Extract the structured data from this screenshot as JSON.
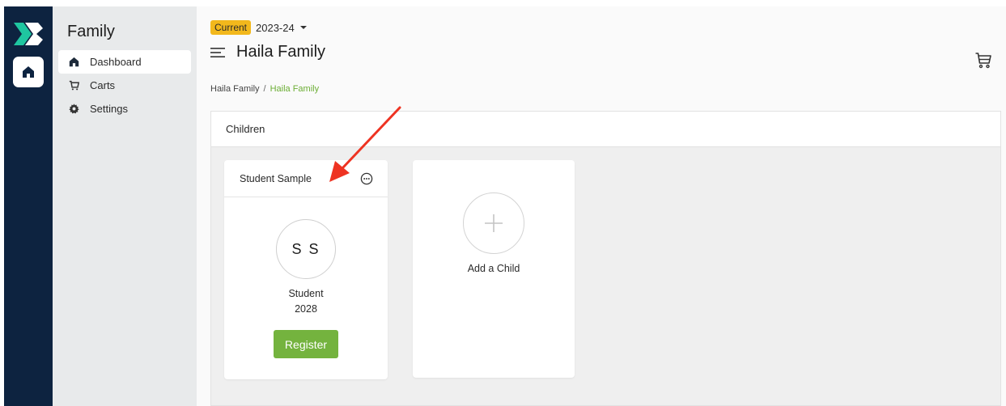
{
  "sidebar": {
    "title": "Family",
    "items": [
      {
        "label": "Dashboard",
        "icon": "home-icon",
        "active": true
      },
      {
        "label": "Carts",
        "icon": "cart-icon",
        "active": false
      },
      {
        "label": "Settings",
        "icon": "gear-icon",
        "active": false
      }
    ]
  },
  "header": {
    "badge": "Current",
    "year": "2023-24",
    "title": "Haila Family"
  },
  "breadcrumb": {
    "items": [
      "Haila Family",
      "Haila Family"
    ],
    "separator": "/"
  },
  "panel": {
    "title": "Children"
  },
  "student_card": {
    "name": "Student Sample",
    "initials": "S S",
    "role": "Student",
    "year": "2028",
    "register_label": "Register"
  },
  "add_card": {
    "label": "Add a Child"
  },
  "colors": {
    "rail": "#0d2340",
    "accent_green": "#74b33e",
    "breadcrumb_green": "#6cae35",
    "badge": "#f2b81c",
    "arrow": "#ee3322"
  }
}
